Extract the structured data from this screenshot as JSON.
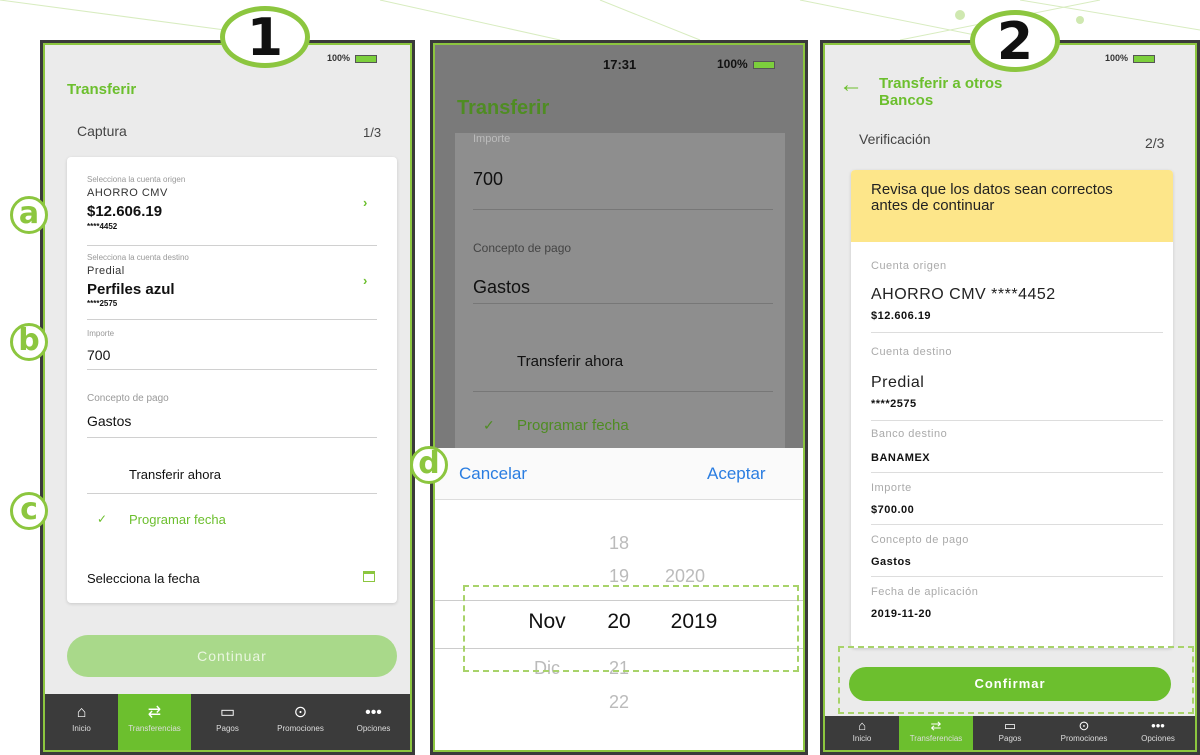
{
  "annotations": {
    "step1": "1",
    "step2": "2",
    "a": "a",
    "b": "b",
    "c": "c",
    "d": "d"
  },
  "panel1": {
    "status_battery": "100%",
    "title": "Transferir",
    "step_label": "Captura",
    "step_count": "1/3",
    "origin": {
      "label": "Selecciona la cuenta origen",
      "name": "AHORRO CMV",
      "amount": "$12.606.19",
      "number": "****4452"
    },
    "destination": {
      "label": "Selecciona la cuenta destino",
      "name": "Predial",
      "alias": "Perfiles azul",
      "number": "****2575"
    },
    "amount": {
      "label": "Importe",
      "value": "700"
    },
    "concept": {
      "label": "Concepto de pago",
      "value": "Gastos"
    },
    "option_now": "Transferir ahora",
    "option_schedule": "Programar fecha",
    "check_mark": "✓",
    "date_label": "Selecciona la fecha",
    "continue_label": "Continuar"
  },
  "panel2": {
    "status_time": "17:31",
    "status_battery": "100%",
    "title": "Transferir",
    "amount_label": "Importe",
    "amount_value": "700",
    "concept_label": "Concepto de pago",
    "concept_value": "Gastos",
    "option_now": "Transferir ahora",
    "option_schedule": "Programar fecha",
    "check_mark": "✓",
    "cancel_label": "Cancelar",
    "accept_label": "Aceptar",
    "picker": {
      "days_above": [
        "18",
        "19"
      ],
      "year_above": "2020",
      "selected_month": "Nov",
      "selected_day": "20",
      "selected_year": "2019",
      "month_below": "Dic",
      "days_below": [
        "21",
        "22"
      ]
    }
  },
  "panel3": {
    "status_battery": "100%",
    "title_line1": "Transferir a otros",
    "title_line2": "Bancos",
    "step_label": "Verificación",
    "step_count": "2/3",
    "notice": "Revisa que los datos sean correctos antes de continuar",
    "origin_label": "Cuenta origen",
    "origin_value": "AHORRO CMV ****4452",
    "origin_amount": "$12.606.19",
    "dest_label": "Cuenta destino",
    "dest_value": "Predial",
    "dest_number": "****2575",
    "bank_label": "Banco destino",
    "bank_value": "BANAMEX",
    "amount_label": "Importe",
    "amount_value": "$700.00",
    "concept_label": "Concepto de pago",
    "concept_value": "Gastos",
    "date_label": "Fecha de aplicación",
    "date_value": "2019-11-20",
    "confirm_label": "Confirmar"
  },
  "tabbar": [
    "Inicio",
    "Transferencias",
    "Pagos",
    "Promociones",
    "Opciones"
  ],
  "colors": {
    "accent": "#6cbf2e",
    "notice": "#fde68a",
    "ios_blue": "#2a7de1"
  }
}
